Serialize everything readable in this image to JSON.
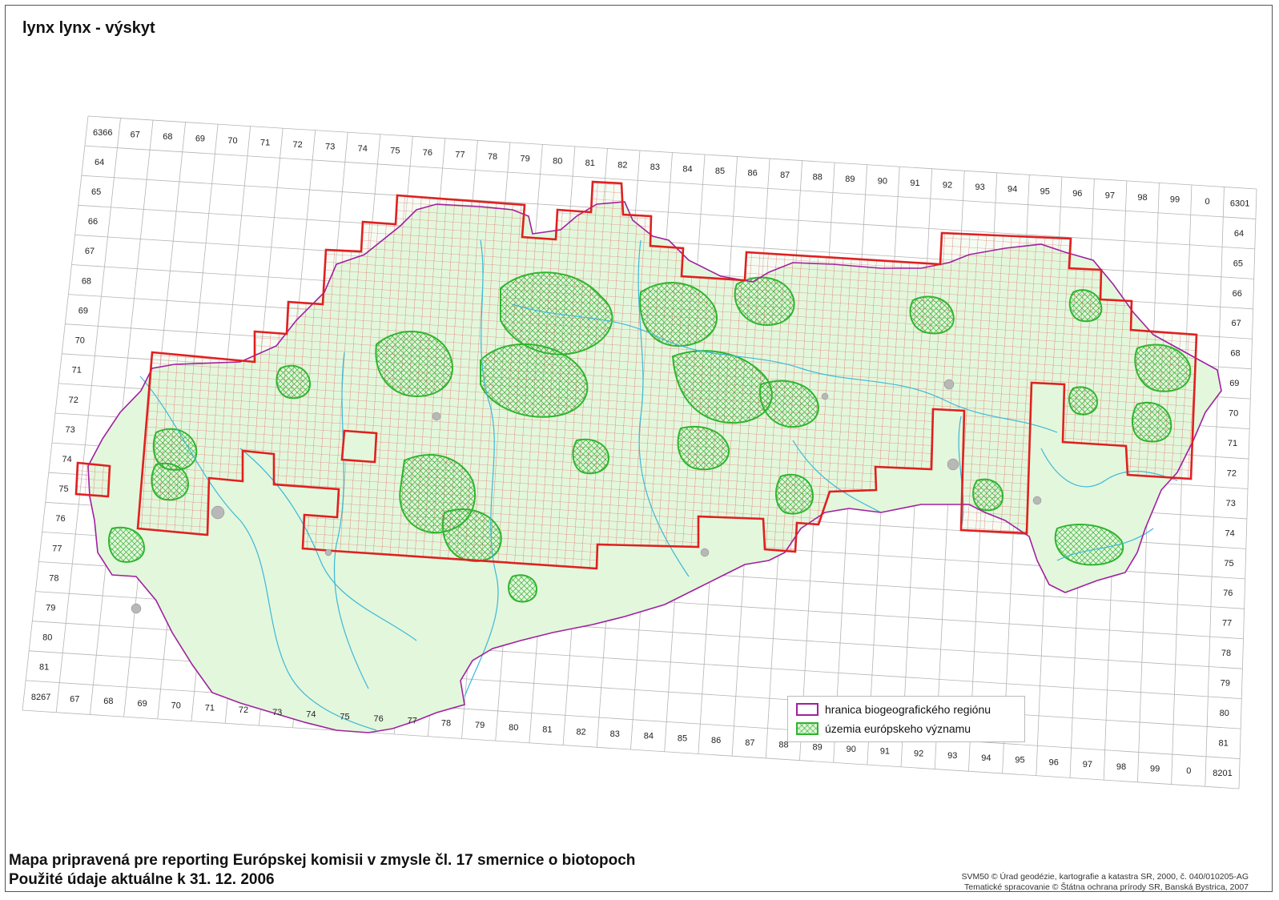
{
  "map": {
    "title": "lynx lynx - výskyt",
    "grid": {
      "top_labels": [
        "6366",
        "67",
        "68",
        "69",
        "70",
        "71",
        "72",
        "73",
        "74",
        "75",
        "76",
        "77",
        "78",
        "79",
        "80",
        "81",
        "82",
        "83",
        "84",
        "85",
        "86",
        "87",
        "88",
        "89",
        "90",
        "91",
        "92",
        "93",
        "94",
        "95",
        "96",
        "97",
        "98",
        "99",
        "0",
        "6301"
      ],
      "bottom_labels": [
        "8267",
        "67",
        "68",
        "69",
        "70",
        "71",
        "72",
        "73",
        "74",
        "75",
        "76",
        "77",
        "78",
        "79",
        "80",
        "81",
        "82",
        "83",
        "84",
        "85",
        "86",
        "87",
        "88",
        "89",
        "90",
        "91",
        "92",
        "93",
        "94",
        "95",
        "96",
        "97",
        "98",
        "99",
        "0",
        "8201"
      ],
      "left_labels": [
        "64",
        "65",
        "66",
        "67",
        "68",
        "69",
        "70",
        "71",
        "72",
        "73",
        "74",
        "75",
        "76",
        "77",
        "78",
        "79",
        "80",
        "81"
      ],
      "right_labels": [
        "64",
        "65",
        "66",
        "67",
        "68",
        "69",
        "70",
        "71",
        "72",
        "73",
        "74",
        "75",
        "76",
        "77",
        "78",
        "79",
        "80",
        "81"
      ]
    },
    "legend": {
      "region_label": "hranica biogeografického regiónu",
      "sci_label": "územia európskeho významu"
    },
    "colors": {
      "occurrence_outline": "#e02020",
      "region_border": "#a020a0",
      "sci_sites": "#2fb52f",
      "land_fill": "#e3f7dc",
      "rivers": "#3cb8d8",
      "grid": "#b4b4b4"
    }
  },
  "footer": {
    "line1": "Mapa pripravená pre reporting Európskej komisii v zmysle čl. 17 smernice o biotopoch",
    "line2": "Použité údaje aktuálne k 31. 12. 2006",
    "credit1": "SVM50 © Úrad geodézie, kartografie a katastra SR, 2000, č. 040/010205-AG",
    "credit2": "Tematické spracovanie © Štátna ochrana prírody SR, Banská Bystrica, 2007"
  }
}
